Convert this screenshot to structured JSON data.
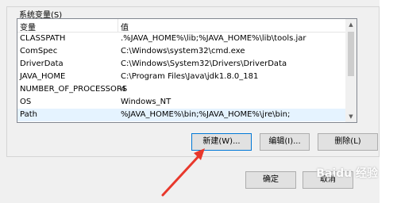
{
  "group": {
    "title": "系统变量(S)"
  },
  "table": {
    "columns": [
      "变量",
      "值"
    ],
    "rows": [
      {
        "name": "CLASSPATH",
        "value": ".%JAVA_HOME%\\lib;%JAVA_HOME%\\lib\\tools.jar"
      },
      {
        "name": "ComSpec",
        "value": "C:\\Windows\\system32\\cmd.exe"
      },
      {
        "name": "DriverData",
        "value": "C:\\Windows\\System32\\Drivers\\DriverData"
      },
      {
        "name": "JAVA_HOME",
        "value": "C:\\Program Files\\Java\\jdk1.8.0_181"
      },
      {
        "name": "NUMBER_OF_PROCESSORS",
        "value": "4"
      },
      {
        "name": "OS",
        "value": "Windows_NT"
      },
      {
        "name": "Path",
        "value": "%JAVA_HOME%\\bin;%JAVA_HOME%\\jre\\bin;"
      }
    ],
    "selected_row": "Path"
  },
  "buttons": {
    "new_label": "新建(W)...",
    "edit_label": "编辑(I)...",
    "delete_label": "删除(L)",
    "ok_label": "确定",
    "cancel_label": "取消"
  },
  "watermark": "Baidu 经验",
  "colors": {
    "selected_row": "#e5f3ff",
    "arrow": "#e8382c",
    "focus_border": "#0078d7"
  }
}
